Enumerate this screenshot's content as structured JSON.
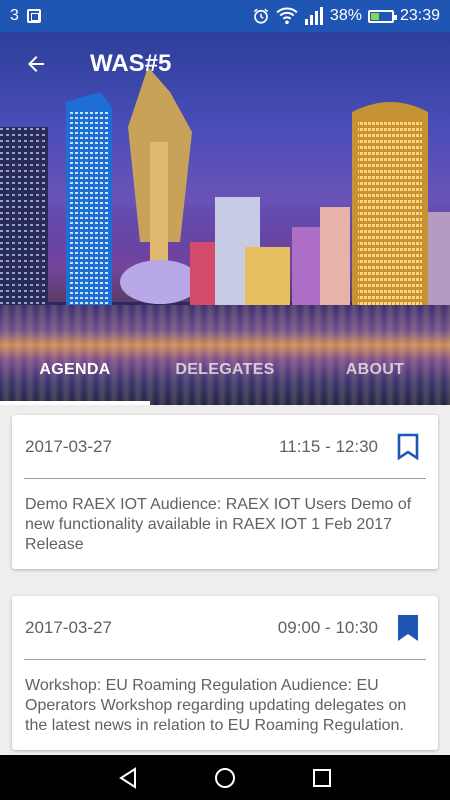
{
  "status_bar": {
    "carrier_number": "3",
    "battery_percent": "38%",
    "battery_level": 0.38,
    "time": "23:39",
    "icons": [
      "sim-icon",
      "alarm-icon",
      "wifi-icon",
      "signal-icon",
      "battery-icon"
    ],
    "background": "#1f56b3"
  },
  "toolbar": {
    "title": "WAS#5",
    "back_icon": "arrow-left-icon"
  },
  "tabs": [
    {
      "label": "AGENDA",
      "active": true
    },
    {
      "label": "DELEGATES",
      "active": false
    },
    {
      "label": "ABOUT",
      "active": false
    }
  ],
  "agenda": [
    {
      "date": "2017-03-27",
      "time": "11:15 - 12:30",
      "bookmarked": false,
      "description": "Demo RAEX IOT Audience: RAEX IOT Users Demo of new functionality available in RAEX IOT 1 Feb 2017 Release"
    },
    {
      "date": "2017-03-27",
      "time": "09:00 - 10:30",
      "bookmarked": true,
      "description": "Workshop: EU Roaming Regulation Audience: EU Operators Workshop regarding updating delegates on the latest news in relation to EU Roaming Regulation."
    }
  ],
  "colors": {
    "accent": "#1f56b3",
    "text_secondary": "#616161"
  },
  "nav_bar": {
    "icons": [
      "back-triangle-icon",
      "home-circle-icon",
      "recents-square-icon"
    ]
  }
}
